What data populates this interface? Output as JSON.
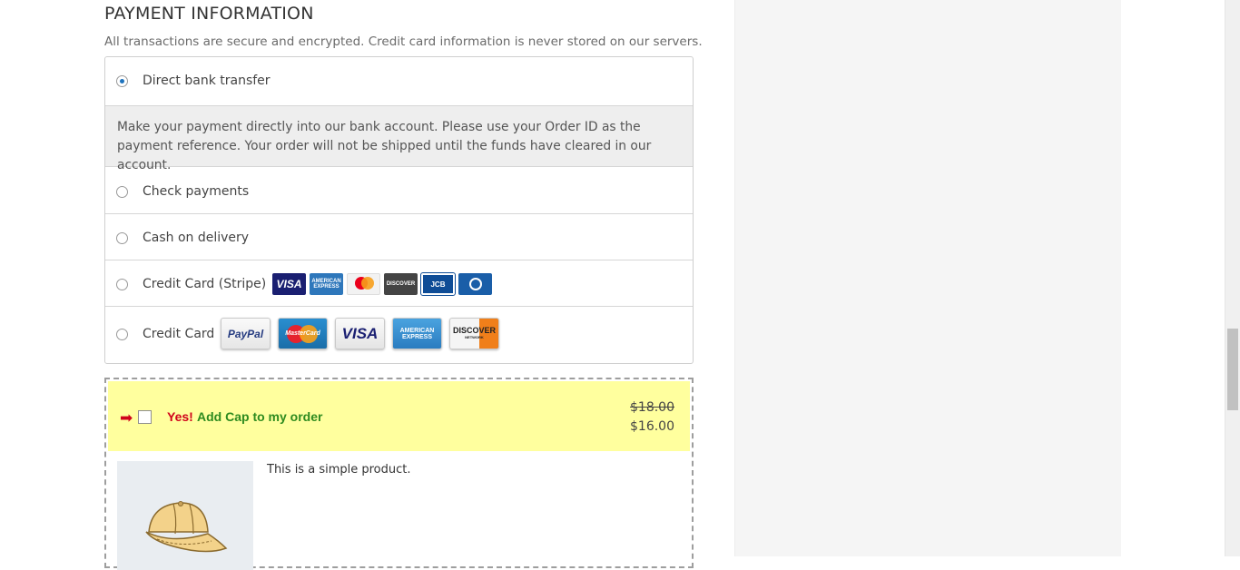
{
  "payment": {
    "title": "PAYMENT INFORMATION",
    "subtitle": "All transactions are secure and encrypted. Credit card information is never stored on our servers.",
    "options": [
      {
        "label": "Direct bank transfer",
        "selected": true
      },
      {
        "label": "Check payments",
        "selected": false
      },
      {
        "label": "Cash on delivery",
        "selected": false
      },
      {
        "label": "Credit Card (Stripe)",
        "selected": false
      },
      {
        "label": "Credit Card",
        "selected": false
      }
    ],
    "bank_description": "Make your payment directly into our bank account. Please use your Order ID as the payment reference. Your order will not be shipped until the funds have cleared in our account.",
    "stripe_cards": [
      "visa-icon",
      "amex-icon",
      "mastercard-icon",
      "discover-icon",
      "jcb-icon",
      "diners-icon"
    ],
    "stripe_card_labels": {
      "visa": "VISA",
      "amex": "AMERICAN EXPRESS",
      "discover": "DISCOVER",
      "jcb": "JCB"
    },
    "credit_cards": [
      "paypal-icon",
      "mastercard-icon",
      "visa-icon",
      "amex-icon",
      "discover-icon"
    ],
    "credit_card_labels": {
      "paypal": "PayPal",
      "mastercard": "MasterCard",
      "visa": "VISA",
      "amex": "AMERICAN EXPRESS",
      "discover": "DISCOVER",
      "discover_sub": "NETWORK"
    }
  },
  "upsell": {
    "yes_label": "Yes!",
    "offer_label": "Add Cap to my order",
    "old_price": "$18.00",
    "new_price": "$16.00",
    "product_description": "This is a simple product.",
    "checked": false
  },
  "colors": {
    "accent": "#1e73be",
    "upsell_bg": "#ffff9e",
    "yes_red": "#d0021b",
    "offer_green": "#2e8b1f"
  }
}
